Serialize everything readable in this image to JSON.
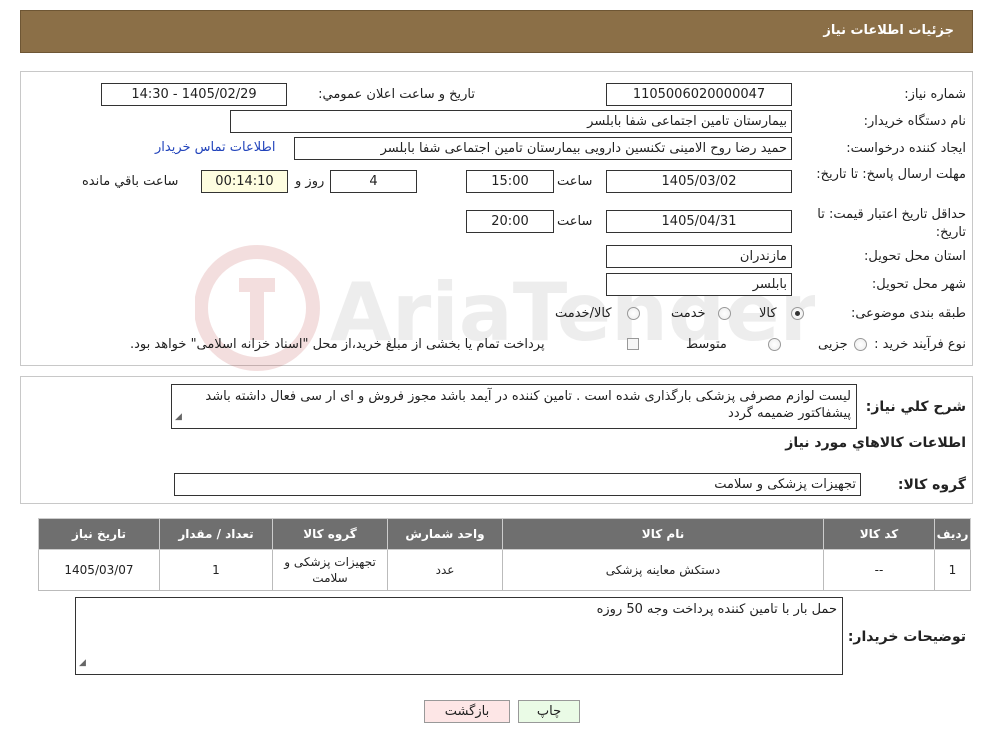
{
  "header": {
    "title": "جزئیات اطلاعات نیاز"
  },
  "form": {
    "need_number_label": "شماره نیاز:",
    "need_number": "1105006020000047",
    "announce_label": "تاريخ و ساعت اعلان عمومي:",
    "announce_value": "1405/02/29 - 14:30",
    "buyer_org_label": "نام دستگاه خريدار:",
    "buyer_org": "بیمارستان تامین اجتماعی شفا بابلسر",
    "creator_label": "ايجاد کننده درخواست:",
    "creator": "حمید رضا روح الامینی تکنسین دارویی بیمارستان تامین اجتماعی شفا بابلسر",
    "contact_link": "اطلاعات تماس خريدار",
    "deadline_label": "مهلت ارسال پاسخ: تا تاريخ:",
    "deadline_date": "1405/03/02",
    "time_label": "ساعت",
    "deadline_time": "15:00",
    "days_value": "4",
    "days_label": "روز و",
    "remaining_time": "00:14:10",
    "remaining_label": "ساعت باقي مانده",
    "validity_label": "حداقل تاريخ اعتبار قيمت: تا تاريخ:",
    "validity_date": "1405/04/31",
    "validity_time": "20:00",
    "province_label": "استان محل تحويل:",
    "province": "مازندران",
    "city_label": "شهر محل تحويل:",
    "city": "بابلسر",
    "category_label": "طبقه بندی موضوعی:",
    "category_options": [
      "کالا",
      "خدمت",
      "کالا/خدمت"
    ],
    "category_selected": 0,
    "purchase_type_label": "نوع فرآیند خرید :",
    "purchase_options": [
      "جزیی",
      "متوسط"
    ],
    "purchase_note": "پرداخت تمام یا بخشی از مبلغ خرید،از محل \"اسناد خزانه اسلامی\" خواهد بود."
  },
  "summary": {
    "desc_label": "شرح کلي نياز:",
    "desc_text": "لیست لوازم مصرفی پزشکی بارگذاری شده است . تامین کننده در آیمد باشد مجوز فروش و ای ار سی فعال داشته باشد پیشفاکتور ضمیمه گردد",
    "goods_info_title": "اطلاعات کالاهاي مورد نياز",
    "goods_group_label": "گروه کالا:",
    "goods_group": "تجهیزات پزشکی و سلامت"
  },
  "table": {
    "headers": [
      "رديف",
      "کد کالا",
      "نام کالا",
      "واحد شمارش",
      "گروه کالا",
      "تعداد / مقدار",
      "تاريخ نياز"
    ],
    "rows": [
      [
        "1",
        "--",
        "دستکش معاینه پزشکی",
        "عدد",
        "تجهیزات پزشکی و سلامت",
        "1",
        "1405/03/07"
      ]
    ]
  },
  "notes": {
    "label": "توضيحات خريدار:",
    "text": "حمل بار با تامین کننده پرداخت وجه 50 روزه"
  },
  "buttons": {
    "print": "چاپ",
    "back": "بازگشت"
  },
  "watermark": {
    "brand": "AriaTender.neT"
  },
  "colors": {
    "header_bg": "#8B6F47",
    "table_header_bg": "#6f6f6f",
    "link": "#2244bb",
    "remaining_bg": "#fefde0",
    "print_bg": "#eafbe6",
    "back_bg": "#fde6e6"
  }
}
